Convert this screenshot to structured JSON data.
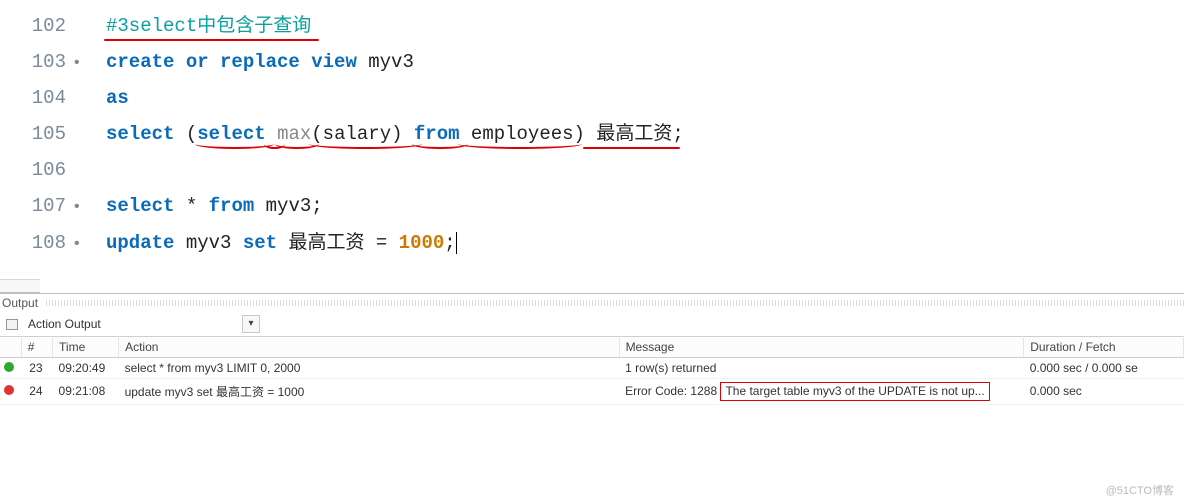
{
  "editor": {
    "lines": [
      {
        "num": "102",
        "hasDot": false,
        "tokens": [
          {
            "cls": "cmt underline-red",
            "text": "#3select中包含子查询"
          }
        ]
      },
      {
        "num": "103",
        "hasDot": true,
        "tokens": [
          {
            "cls": "kw",
            "text": "create or replace view"
          },
          {
            "cls": "txt",
            "text": " myv3"
          }
        ]
      },
      {
        "num": "104",
        "hasDot": false,
        "tokens": [
          {
            "cls": "kw",
            "text": "as"
          }
        ]
      },
      {
        "num": "105",
        "hasDot": false,
        "tokens": [
          {
            "cls": "kw",
            "text": "select"
          },
          {
            "cls": "txt",
            "text": " ("
          },
          {
            "cls": "kw underline-red curve",
            "text": "select"
          },
          {
            "cls": "txt underline-red curve",
            "text": " "
          },
          {
            "cls": "fn underline-red curve",
            "text": "max"
          },
          {
            "cls": "txt underline-red curve",
            "text": "(salary) "
          },
          {
            "cls": "kw underline-red curve",
            "text": "from"
          },
          {
            "cls": "txt underline-red curve",
            "text": " employees"
          },
          {
            "cls": "txt",
            "text": ")"
          },
          {
            "cls": "cjk underline-red",
            "text": " 最高工资"
          },
          {
            "cls": "txt",
            "text": ";"
          }
        ]
      },
      {
        "num": "106",
        "hasDot": false,
        "tokens": []
      },
      {
        "num": "107",
        "hasDot": true,
        "tokens": [
          {
            "cls": "kw",
            "text": "select"
          },
          {
            "cls": "txt",
            "text": " * "
          },
          {
            "cls": "kw",
            "text": "from"
          },
          {
            "cls": "txt",
            "text": " myv3;"
          }
        ]
      },
      {
        "num": "108",
        "hasDot": true,
        "tokens": [
          {
            "cls": "kw",
            "text": "update"
          },
          {
            "cls": "txt",
            "text": " myv3 "
          },
          {
            "cls": "kw",
            "text": "set"
          },
          {
            "cls": "txt",
            "text": " 最高工资 = "
          },
          {
            "cls": "num",
            "text": "1000"
          },
          {
            "cls": "txt",
            "text": ";"
          }
        ],
        "cursor": true
      }
    ]
  },
  "output": {
    "panel_title": "Output",
    "toolbar_label": "Action Output",
    "columns": {
      "idx": "#",
      "time": "Time",
      "action": "Action",
      "message": "Message",
      "duration": "Duration / Fetch"
    },
    "rows": [
      {
        "status": "ok",
        "idx": "23",
        "time": "09:20:49",
        "action": "select * from myv3 LIMIT 0, 2000",
        "message": "1 row(s) returned",
        "message_boxed": false,
        "duration": "0.000 sec / 0.000 se"
      },
      {
        "status": "err",
        "idx": "24",
        "time": "09:21:08",
        "action": "update myv3 set 最高工资 = 1000",
        "message_prefix": "Error Code: 1288",
        "message": "The target table myv3 of the UPDATE is not up...",
        "message_boxed": true,
        "duration": "0.000 sec"
      }
    ]
  },
  "watermark": "@51CTO博客"
}
